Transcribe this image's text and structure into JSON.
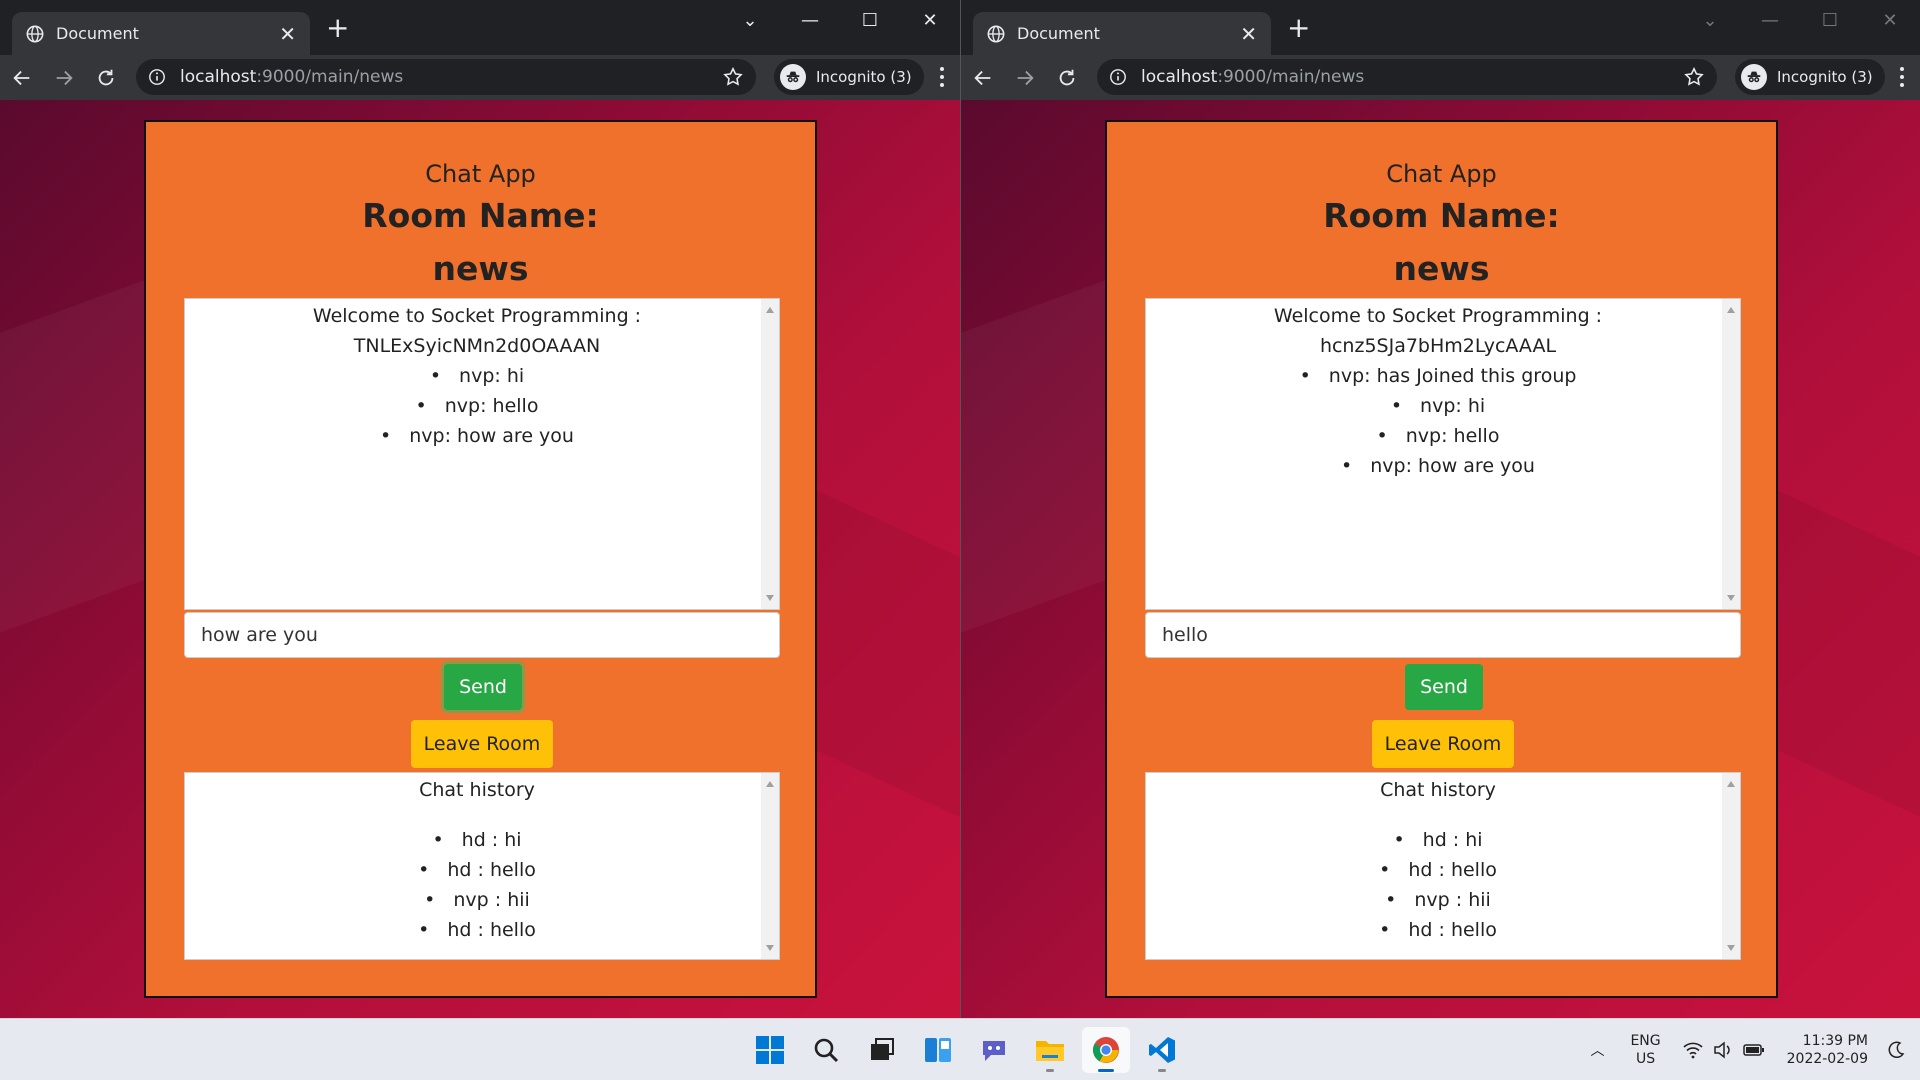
{
  "browser": {
    "tab_title": "Document",
    "url_host": "localhost",
    "url_path": ":9000/main/news",
    "incognito_label": "Incognito (3)",
    "accent": "#35363a"
  },
  "left": {
    "app_title": "Chat App",
    "room_label": "Room Name:",
    "room_name": "news",
    "welcome": "Welcome to Socket Programming : TNLExSyicNMn2d0OAAAN",
    "messages": [
      "nvp: hi",
      "nvp: hello",
      "nvp: how are you"
    ],
    "input_value": "how are you",
    "send_label": "Send",
    "leave_label": "Leave Room",
    "history_title": "Chat history",
    "history": [
      "hd : hi",
      "hd : hello",
      "nvp : hii",
      "hd : hello"
    ]
  },
  "right": {
    "app_title": "Chat App",
    "room_label": "Room Name:",
    "room_name": "news",
    "welcome": "Welcome to Socket Programming : hcnz5SJa7bHm2LycAAAL",
    "messages": [
      "nvp: has Joined this group",
      "nvp: hi",
      "nvp: hello",
      "nvp: how are you"
    ],
    "input_value": "hello",
    "send_label": "Send",
    "leave_label": "Leave Room",
    "history_title": "Chat history",
    "history": [
      "hd : hi",
      "hd : hello",
      "nvp : hii",
      "hd : hello"
    ]
  },
  "colors": {
    "app_bg": "#f0712b",
    "send": "#28a745",
    "leave": "#ffc107"
  },
  "taskbar": {
    "icons": [
      "windows-start-icon",
      "search-icon",
      "task-view-icon",
      "widgets-icon",
      "teams-chat-icon",
      "file-explorer-icon",
      "chrome-icon",
      "vscode-icon"
    ],
    "lang_1": "ENG",
    "lang_2": "US",
    "time": "11:39 PM",
    "date": "2022-02-09"
  }
}
